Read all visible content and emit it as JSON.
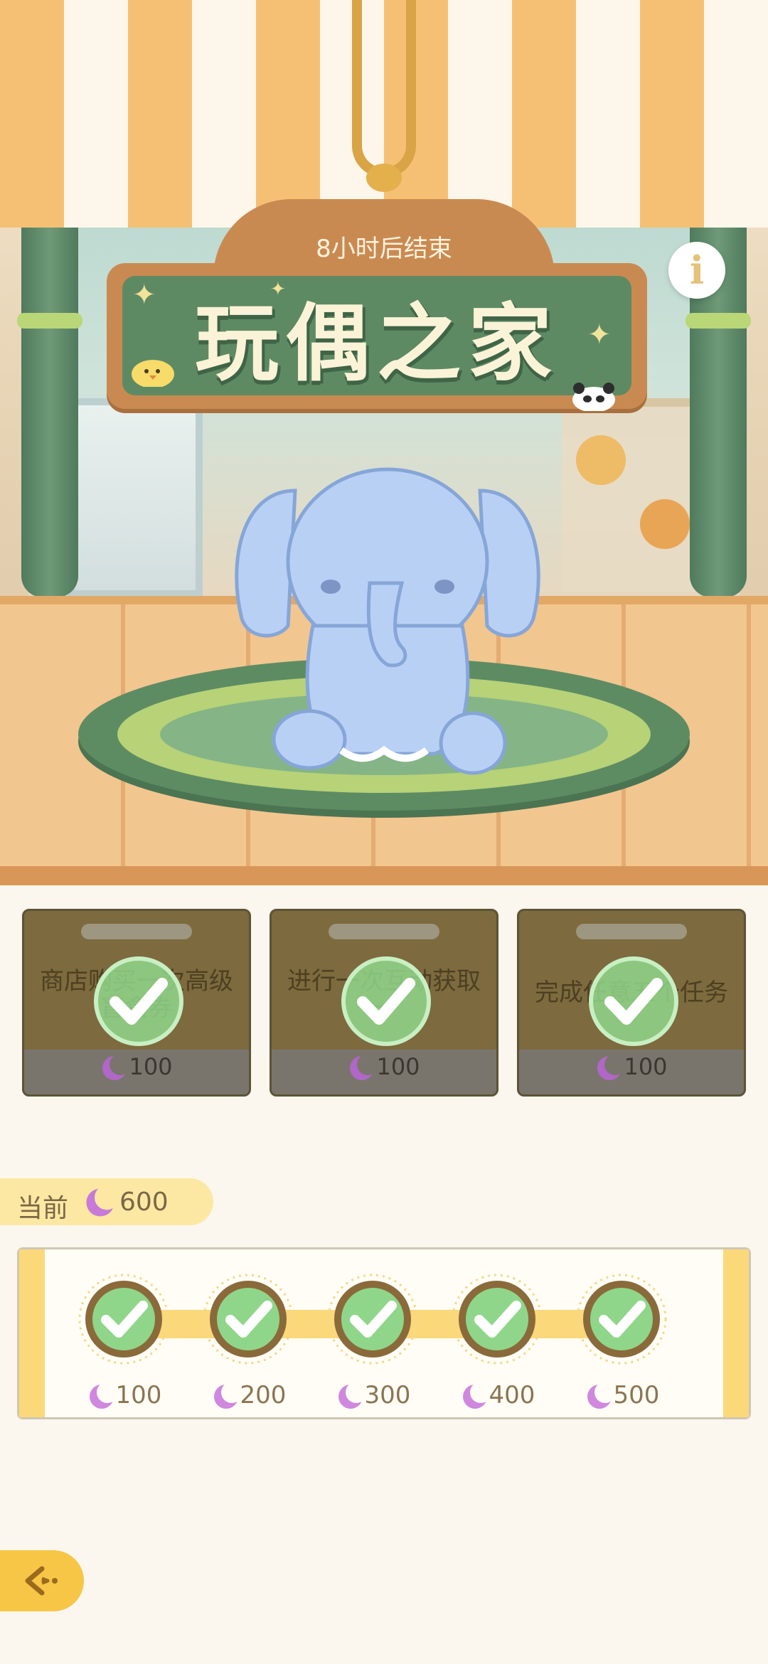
{
  "event": {
    "timer": "8小时后结束",
    "title": "玩偶之家",
    "info_label": "i"
  },
  "tasks": [
    {
      "name": "商店购买一次高级盲盒券",
      "reward": "100",
      "completed": true
    },
    {
      "name": "进行一次互动获取一",
      "reward": "100",
      "completed": true
    },
    {
      "name": "完成任意五个任务",
      "reward": "100",
      "completed": true
    }
  ],
  "progress": {
    "current_label": "当前",
    "current_value": "600",
    "milestones": [
      {
        "value": "100",
        "claimed": true
      },
      {
        "value": "200",
        "claimed": true
      },
      {
        "value": "300",
        "claimed": true
      },
      {
        "value": "400",
        "claimed": true
      },
      {
        "value": "500",
        "claimed": true
      }
    ]
  },
  "icons": {
    "currency": "moon-icon",
    "check": "checkmark-icon",
    "back": "back-arrow-icon"
  },
  "colors": {
    "check_green": "#8fd68a",
    "sign_green": "#5e8a63",
    "accent_yellow": "#fbd87a",
    "moon_purple": "#b067c7"
  }
}
